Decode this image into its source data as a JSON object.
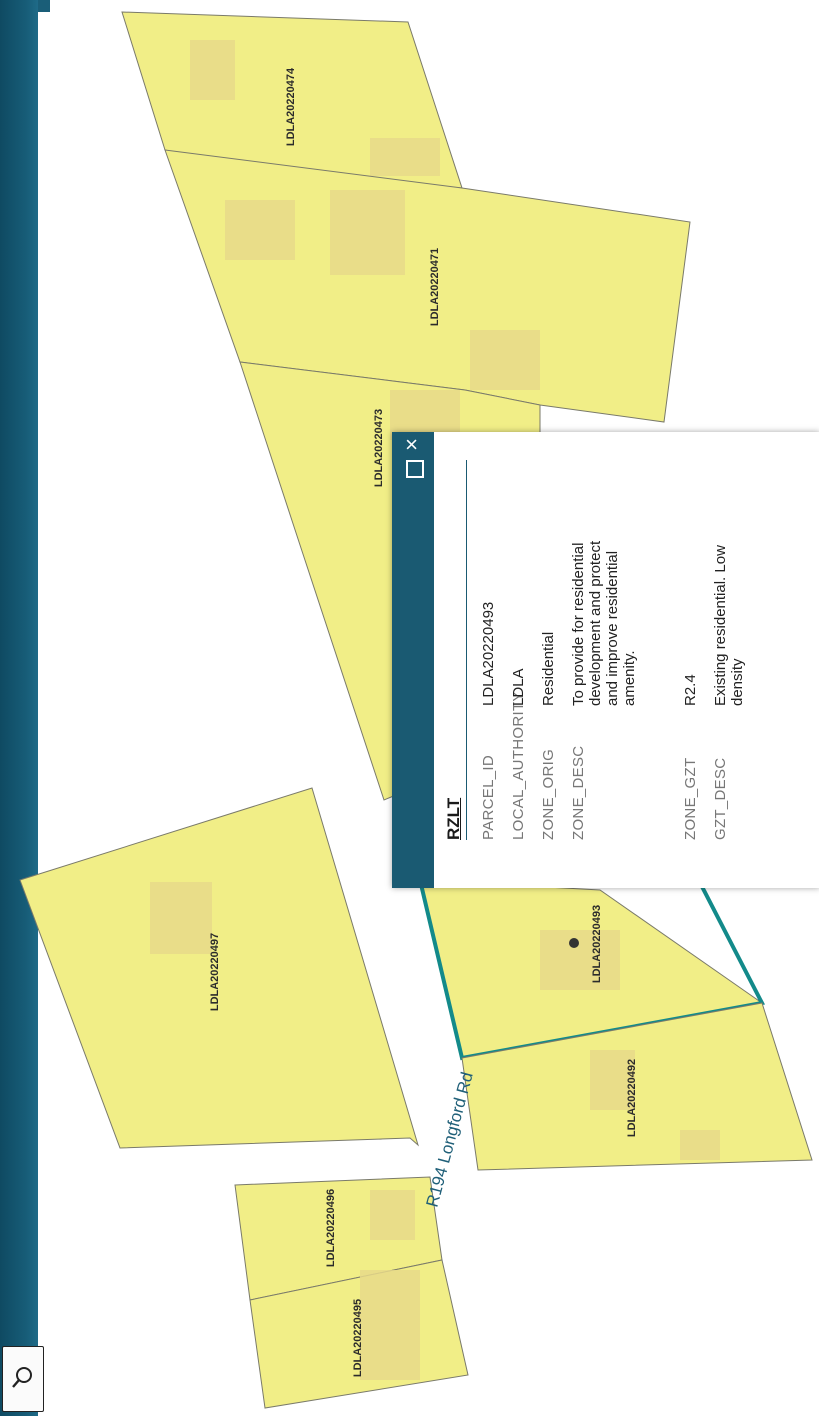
{
  "map": {
    "road_label": "R194 Longford Rd",
    "parcel_fill": "#f1ee87",
    "highlight_color": "#138a8a",
    "parcels": [
      {
        "id": "p-20474",
        "label": "LDLA20220474"
      },
      {
        "id": "p-20471",
        "label": "LDLA20220471"
      },
      {
        "id": "p-20473",
        "label": "LDLA20220473"
      },
      {
        "id": "p-20497",
        "label": "LDLA20220497"
      },
      {
        "id": "p-20493",
        "label": "LDLA20220493"
      },
      {
        "id": "p-20492",
        "label": "LDLA20220492"
      },
      {
        "id": "p-20496",
        "label": "LDLA20220496"
      },
      {
        "id": "p-20495",
        "label": "LDLA20220495"
      }
    ]
  },
  "search": {
    "icon": "search-icon"
  },
  "popup": {
    "title": "RZLT",
    "maximize_icon": "maximize-icon",
    "close_icon": "close-icon",
    "close_label": "×",
    "fields": [
      {
        "key": "PARCEL_ID",
        "value": "LDLA20220493"
      },
      {
        "key": "LOCAL_AUTHORITY",
        "value": "LDLA"
      },
      {
        "key": "ZONE_ORIG",
        "value": "Residential"
      },
      {
        "key": "ZONE_DESC",
        "value": "To provide for residential development and protect and improve residential amenity."
      },
      {
        "key": "ZONE_GZT",
        "value": "R2.4"
      },
      {
        "key": "GZT_DESC",
        "value": "Existing residential. Low density"
      }
    ]
  }
}
